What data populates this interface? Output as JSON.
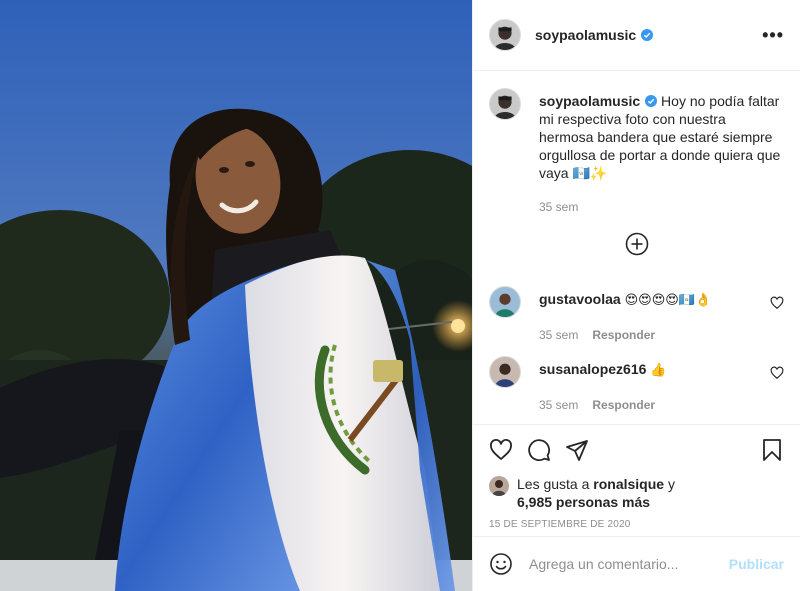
{
  "post": {
    "username": "soypaolamusic",
    "verified": true,
    "more_label": "•••"
  },
  "caption": {
    "username": "soypaolamusic",
    "text": "Hoy no podía faltar mi respectiva foto con nuestra hermosa bandera que estaré siempre orgullosa de portar a donde quiera que vaya 🇬🇹✨",
    "time": "35 sem"
  },
  "comments": [
    {
      "username": "gustavoolaa",
      "text": "😍😍😍😍🇬🇹👌",
      "time": "35 sem",
      "reply_label": "Responder"
    },
    {
      "username": "susanalopez616",
      "text": "👍",
      "time": "35 sem",
      "reply_label": "Responder"
    }
  ],
  "likes": {
    "prefix": "Les gusta a ",
    "liker": "ronalsique",
    "connector": " y",
    "others": "6,985 personas más"
  },
  "date": "15 DE SEPTIEMBRE DE 2020",
  "composer": {
    "placeholder": "Agrega un comentario...",
    "publish_label": "Publicar"
  },
  "icons": [
    "more-icon",
    "verified-icon",
    "load-more-icon",
    "heart-icon",
    "comment-icon",
    "share-icon",
    "save-icon",
    "emoji-icon"
  ],
  "colors": {
    "verified": "#3897f0",
    "publish_disabled": "#b2dffc",
    "muted": "#8e8e8e"
  }
}
